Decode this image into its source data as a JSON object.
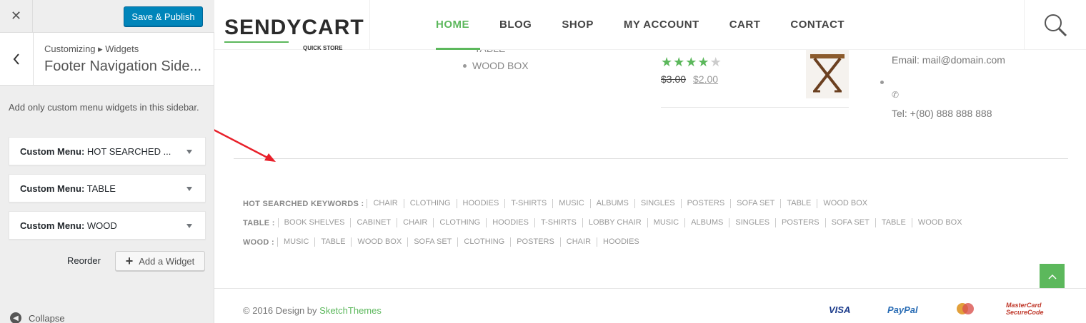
{
  "customizer": {
    "close_icon": "close-icon",
    "save_label": "Save & Publish",
    "breadcrumb": "Customizing ▸ Widgets",
    "panel_title": "Footer Navigation Side...",
    "description": "Add only custom menu widgets in this sidebar.",
    "widgets": [
      {
        "type": "Custom Menu:",
        "name": "HOT SEARCHED ..."
      },
      {
        "type": "Custom Menu:",
        "name": "TABLE"
      },
      {
        "type": "Custom Menu:",
        "name": "WOOD"
      }
    ],
    "reorder_label": "Reorder",
    "add_widget_label": "Add a Widget",
    "collapse_label": "Collapse"
  },
  "site": {
    "logo_text": "SENDYCART",
    "logo_subtitle": "QUICK STORE",
    "nav": [
      "HOME",
      "BLOG",
      "SHOP",
      "MY ACCOUNT",
      "CART",
      "CONTACT"
    ],
    "active_nav": "HOME",
    "accent_color": "#5cb85c"
  },
  "footer_widgets": {
    "list_partial": "TABLE",
    "list_item": "WOOD BOX",
    "product": {
      "rating": 4.5,
      "price_old": "$3.00",
      "price_new": "$2.00"
    },
    "email": "Email: mail@domain.com",
    "tel": "Tel: +(80) 888 888 888"
  },
  "keywords": [
    {
      "label": "HOT SEARCHED KEYWORDS :",
      "items": [
        "CHAIR",
        "CLOTHING",
        "HOODIES",
        "T-SHIRTS",
        "MUSIC",
        "ALBUMS",
        "SINGLES",
        "POSTERS",
        "SOFA SET",
        "TABLE",
        "WOOD BOX"
      ]
    },
    {
      "label": "TABLE :",
      "items": [
        "BOOK SHELVES",
        "CABINET",
        "CHAIR",
        "CLOTHING",
        "HOODIES",
        "T-SHIRTS",
        "LOBBY CHAIR",
        "MUSIC",
        "ALBUMS",
        "SINGLES",
        "POSTERS",
        "SOFA SET",
        "TABLE",
        "WOOD BOX"
      ]
    },
    {
      "label": "WOOD :",
      "items": [
        "MUSIC",
        "TABLE",
        "WOOD BOX",
        "SOFA SET",
        "CLOTHING",
        "POSTERS",
        "CHAIR",
        "HOODIES"
      ]
    }
  ],
  "bottom": {
    "copyright_prefix": "© 2016 Design by ",
    "copyright_brand": "SketchThemes",
    "payments": [
      "VISA",
      "PayPal",
      "MasterCard",
      "MasterCard SecureCode"
    ]
  }
}
